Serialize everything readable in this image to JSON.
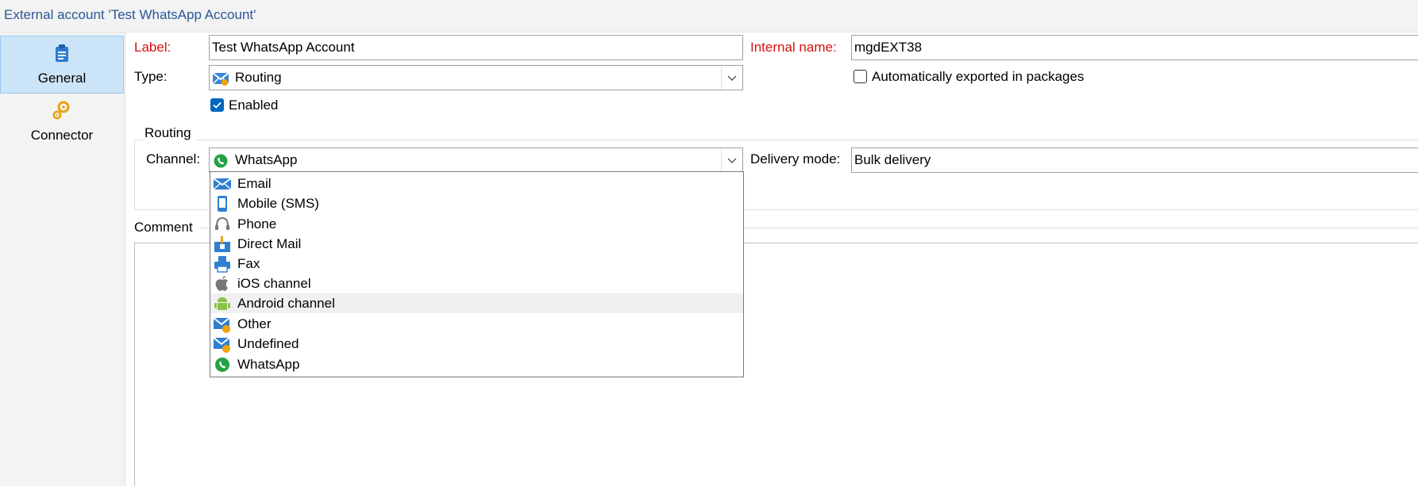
{
  "window": {
    "title": "External account 'Test WhatsApp Account'"
  },
  "sidebar": {
    "tabs": [
      {
        "label": "General",
        "icon": "clipboard-icon",
        "active": true
      },
      {
        "label": "Connector",
        "icon": "gears-icon",
        "active": false
      }
    ]
  },
  "form": {
    "label_caption": "Label:",
    "label_value": "Test WhatsApp Account",
    "internal_name_caption": "Internal name:",
    "internal_name_value": "mgdEXT38",
    "type_caption": "Type:",
    "type_value": "Routing",
    "auto_export_label": "Automatically exported in packages",
    "auto_export_checked": false,
    "enabled_label": "Enabled",
    "enabled_checked": true
  },
  "routing": {
    "group_title": "Routing",
    "channel_caption": "Channel:",
    "channel_value": "WhatsApp",
    "delivery_mode_caption": "Delivery mode:",
    "delivery_mode_value": "Bulk delivery"
  },
  "comment": {
    "group_title": "Comment"
  },
  "channel_dropdown": {
    "items": [
      {
        "label": "Email",
        "icon": "email-icon"
      },
      {
        "label": "Mobile (SMS)",
        "icon": "mobile-icon"
      },
      {
        "label": "Phone",
        "icon": "headset-icon"
      },
      {
        "label": "Direct Mail",
        "icon": "mailbox-icon"
      },
      {
        "label": "Fax",
        "icon": "fax-icon"
      },
      {
        "label": "iOS channel",
        "icon": "apple-icon"
      },
      {
        "label": "Android channel",
        "icon": "android-icon",
        "highlighted": true
      },
      {
        "label": "Other",
        "icon": "envelope-other-icon"
      },
      {
        "label": "Undefined",
        "icon": "envelope-undefined-icon"
      },
      {
        "label": "WhatsApp",
        "icon": "whatsapp-icon"
      }
    ]
  },
  "colors": {
    "required_label": "#d4120f",
    "title_text": "#2b5797",
    "active_tab_bg": "#cce4f7",
    "checkbox_checked": "#0067c0",
    "whatsapp_green": "#25a244"
  }
}
